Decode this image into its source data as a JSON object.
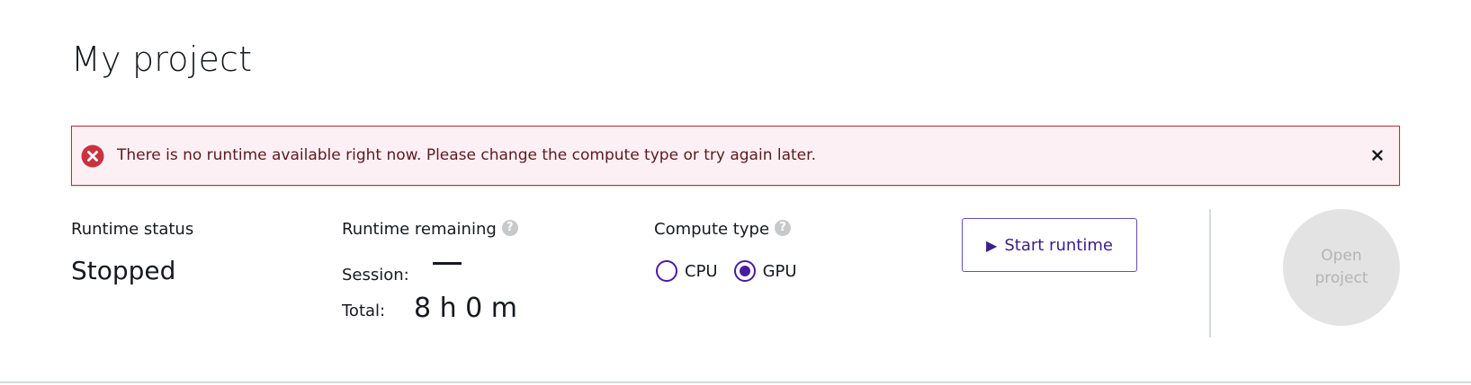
{
  "page": {
    "title": "My project"
  },
  "alert": {
    "message": "There is no runtime available right now. Please change the compute type or try again later.",
    "icon": "error-circle-x-icon",
    "close_icon": "close-icon",
    "color": "#b5303b",
    "background": "#fdf0f4"
  },
  "runtime_status": {
    "label": "Runtime status",
    "value": "Stopped"
  },
  "runtime_remaining": {
    "label": "Runtime remaining",
    "help_icon": "help-circle-icon",
    "help_glyph": "?",
    "session_label": "Session:",
    "session_value": "—",
    "total_label": "Total:",
    "total_value": "8 h 0 m"
  },
  "compute_type": {
    "label": "Compute type",
    "help_icon": "help-circle-icon",
    "help_glyph": "?",
    "options": [
      {
        "label": "CPU",
        "selected": false
      },
      {
        "label": "GPU",
        "selected": true
      }
    ],
    "accent": "#4b1b9e"
  },
  "start_runtime": {
    "label": "Start runtime",
    "icon": "play-icon"
  },
  "open_project": {
    "label_line1": "Open",
    "label_line2": "project",
    "disabled": true
  }
}
